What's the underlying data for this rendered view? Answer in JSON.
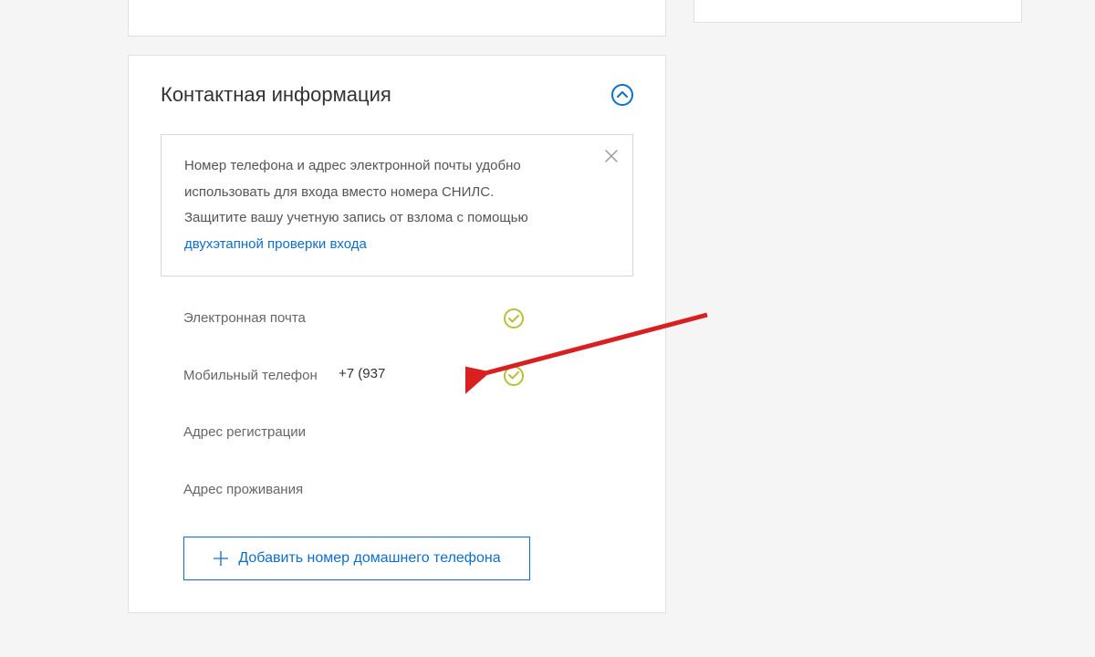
{
  "section": {
    "title": "Контактная информация"
  },
  "info_box": {
    "line1": "Номер телефона и адрес электронной почты удобно использовать для входа вместо номера СНИЛС.",
    "line2_prefix": "Защитите вашу учетную запись от взлома с помощью ",
    "two_step_link": "двухэтапной проверки входа"
  },
  "fields": {
    "email": {
      "label": "Электронная почта",
      "value": ""
    },
    "mobile": {
      "label": "Мобильный телефон",
      "value": "+7 (937"
    },
    "reg_address": {
      "label": "Адрес регистрации",
      "value": ""
    },
    "res_address": {
      "label": "Адрес проживания",
      "value": ""
    }
  },
  "add_home_phone": "Добавить номер домашнего телефона",
  "icons": {
    "collapse": "chevron-up",
    "close": "x",
    "check": "checkmark",
    "plus": "plus"
  },
  "colors": {
    "accent": "#0d6ecc",
    "check": "#b8bf3a",
    "arrow": "#d92020"
  }
}
